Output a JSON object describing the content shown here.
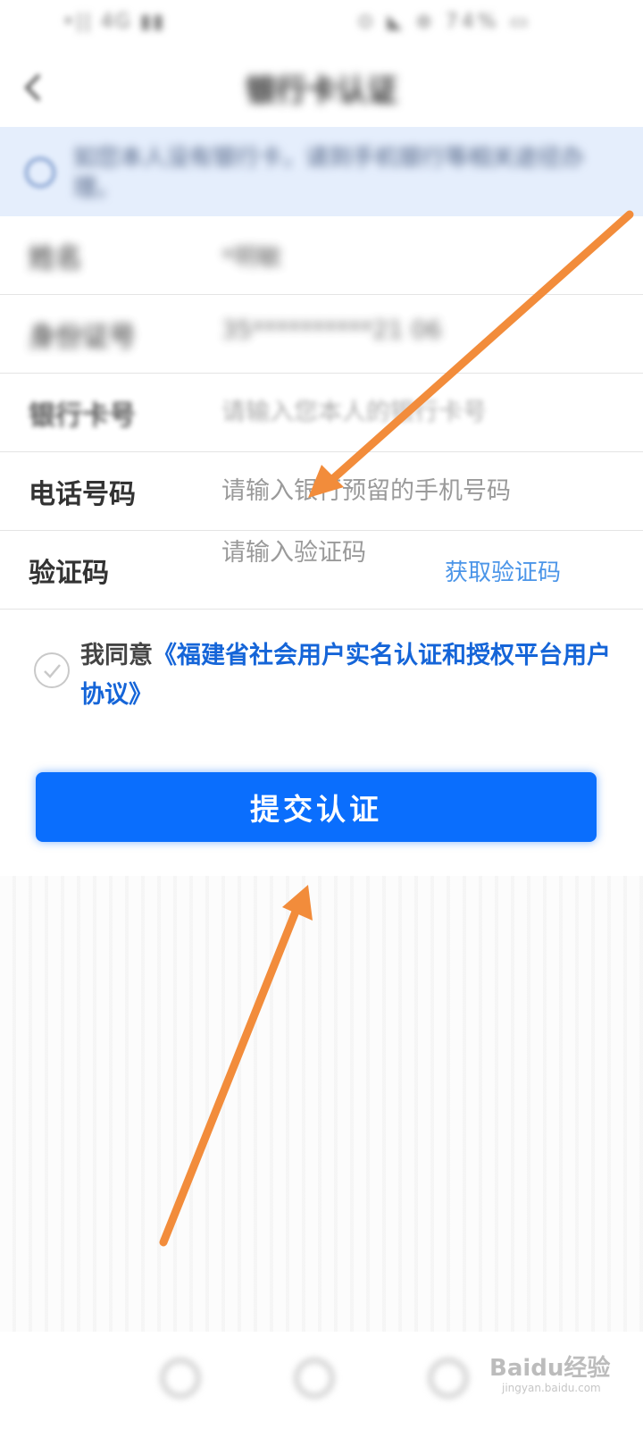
{
  "status_bar": {
    "left": "•|| 4G ▮▮",
    "right": "⊙ ◣ ⊛ 74% ▭"
  },
  "nav": {
    "title": "银行卡认证"
  },
  "notice": {
    "text": "如您本人没有银行卡，请到手机银行等相关途径办理。"
  },
  "form": {
    "name": {
      "label": "姓名",
      "value": "*明敏"
    },
    "id_number": {
      "label": "身份证号",
      "value": "35**********21 06"
    },
    "bank_card": {
      "label": "银行卡号",
      "placeholder": "请输入您本人的银行卡号"
    },
    "phone": {
      "label": "电话号码",
      "placeholder": "请输入银行预留的手机号码"
    },
    "verify_code": {
      "label": "验证码",
      "placeholder": "请输入验证码",
      "get_code": "获取验证码"
    }
  },
  "agreement": {
    "prefix": "我同意",
    "link": "《福建省社会用户实名认证和授权平台用户协议》"
  },
  "submit_label": "提交认证",
  "watermark": {
    "text": "Baidu经验",
    "url": "jingyan.baidu.com"
  },
  "colors": {
    "primary": "#0a6efd",
    "link": "#1565d8",
    "arrow": "#f28c3b",
    "notice_bg": "#e5eefc"
  },
  "annotations": [
    "arrow-pointing-to-phone-field",
    "arrow-pointing-to-submit-button"
  ]
}
